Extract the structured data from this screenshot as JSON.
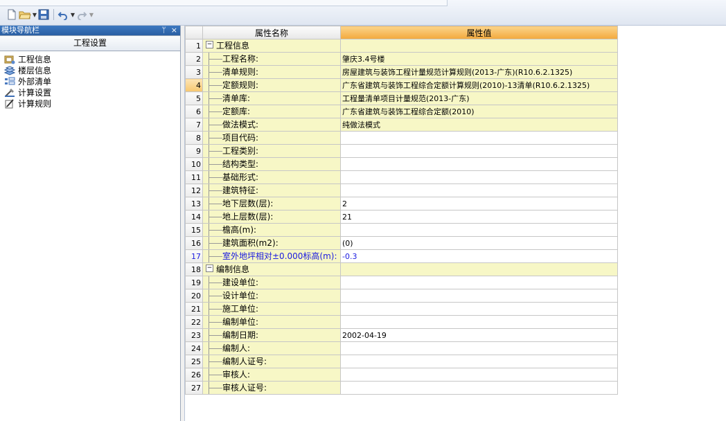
{
  "toolbar": {
    "icons": [
      "new-file-icon",
      "open-folder-icon",
      "save-icon",
      "undo-icon",
      "redo-icon"
    ]
  },
  "nav": {
    "header": "模块导航栏",
    "pin": "ᛘ",
    "close": "×",
    "title": "工程设置",
    "items": [
      {
        "label": "工程信息",
        "icon": "project-info-icon"
      },
      {
        "label": "楼层信息",
        "icon": "floor-info-icon"
      },
      {
        "label": "外部清单",
        "icon": "external-list-icon"
      },
      {
        "label": "计算设置",
        "icon": "calc-settings-icon"
      },
      {
        "label": "计算规则",
        "icon": "calc-rules-icon"
      }
    ]
  },
  "grid": {
    "headers": {
      "name": "属性名称",
      "value": "属性值"
    },
    "rows": [
      {
        "num": "1",
        "name": "工程信息",
        "value": "",
        "group": true,
        "expander": "−"
      },
      {
        "num": "2",
        "name": "工程名称:",
        "value": "肇庆3.4号楼",
        "hl": true
      },
      {
        "num": "3",
        "name": "清单规则:",
        "value": "房屋建筑与装饰工程计量规范计算规则(2013-广东)(R10.6.2.1325)",
        "hl": true
      },
      {
        "num": "4",
        "name": "定额规则:",
        "value": "广东省建筑与装饰工程综合定额计算规则(2010)-13清单(R10.6.2.1325)",
        "hl": true,
        "active": true
      },
      {
        "num": "5",
        "name": "清单库:",
        "value": "工程量清单项目计量规范(2013-广东)",
        "hl": true
      },
      {
        "num": "6",
        "name": "定额库:",
        "value": "广东省建筑与装饰工程综合定额(2010)",
        "hl": true
      },
      {
        "num": "7",
        "name": "做法模式:",
        "value": "纯做法模式",
        "hl": true
      },
      {
        "num": "8",
        "name": "项目代码:",
        "value": ""
      },
      {
        "num": "9",
        "name": "工程类别:",
        "value": ""
      },
      {
        "num": "10",
        "name": "结构类型:",
        "value": ""
      },
      {
        "num": "11",
        "name": "基础形式:",
        "value": ""
      },
      {
        "num": "12",
        "name": "建筑特征:",
        "value": ""
      },
      {
        "num": "13",
        "name": "地下层数(层):",
        "value": "2"
      },
      {
        "num": "14",
        "name": "地上层数(层):",
        "value": "21"
      },
      {
        "num": "15",
        "name": "檐高(m):",
        "value": ""
      },
      {
        "num": "16",
        "name": "建筑面积(m2):",
        "value": "(0)"
      },
      {
        "num": "17",
        "name": "室外地坪相对±0.000标高(m):",
        "value": "-0.3",
        "blue": true
      },
      {
        "num": "18",
        "name": "编制信息",
        "value": "",
        "group": true,
        "expander": "−"
      },
      {
        "num": "19",
        "name": "建设单位:",
        "value": ""
      },
      {
        "num": "20",
        "name": "设计单位:",
        "value": ""
      },
      {
        "num": "21",
        "name": "施工单位:",
        "value": ""
      },
      {
        "num": "22",
        "name": "编制单位:",
        "value": ""
      },
      {
        "num": "23",
        "name": "编制日期:",
        "value": "2002-04-19"
      },
      {
        "num": "24",
        "name": "编制人:",
        "value": ""
      },
      {
        "num": "25",
        "name": "编制人证号:",
        "value": ""
      },
      {
        "num": "26",
        "name": "审核人:",
        "value": ""
      },
      {
        "num": "27",
        "name": "审核人证号:",
        "value": ""
      }
    ]
  }
}
